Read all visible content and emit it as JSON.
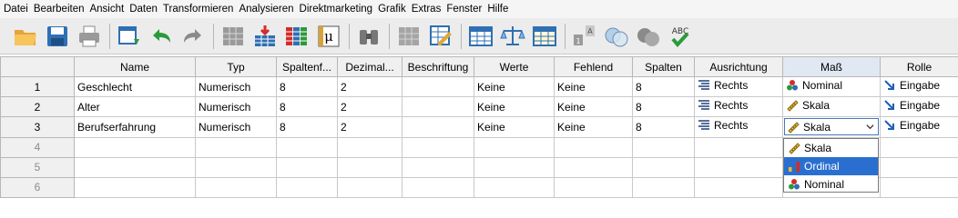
{
  "menu": [
    "Datei",
    "Bearbeiten",
    "Ansicht",
    "Daten",
    "Transformieren",
    "Analysieren",
    "Direktmarketing",
    "Grafik",
    "Extras",
    "Fenster",
    "Hilfe"
  ],
  "toolbar": {
    "icons": [
      "open-folder-icon",
      "save-icon",
      "print-icon",
      "recall-dialog-icon",
      "undo-icon",
      "redo-icon",
      "goto-case-icon",
      "goto-variable-icon",
      "variables-icon",
      "run-descriptives-icon",
      "find-icon",
      "insert-cases-icon",
      "insert-variable-icon",
      "split-file-icon",
      "weight-cases-icon",
      "select-cases-icon",
      "value-labels-icon",
      "use-sets-icon",
      "show-all-variables-icon",
      "spell-check-icon"
    ],
    "spell_label": "ABC"
  },
  "grid": {
    "headers": [
      "Name",
      "Typ",
      "Spaltenf...",
      "Dezimal...",
      "Beschriftung",
      "Werte",
      "Fehlend",
      "Spalten",
      "Ausrichtung",
      "Maß",
      "Rolle"
    ],
    "rows": [
      {
        "num": "1",
        "name": "Geschlecht",
        "typ": "Numerisch",
        "spaltenf": "8",
        "dezimal": "2",
        "beschriftung": "",
        "werte": "Keine",
        "fehlend": "Keine",
        "spalten": "8",
        "ausrichtung": "Rechts",
        "mass": "Nominal",
        "rolle": "Eingabe"
      },
      {
        "num": "2",
        "name": "Alter",
        "typ": "Numerisch",
        "spaltenf": "8",
        "dezimal": "2",
        "beschriftung": "",
        "werte": "Keine",
        "fehlend": "Keine",
        "spalten": "8",
        "ausrichtung": "Rechts",
        "mass": "Skala",
        "rolle": "Eingabe"
      },
      {
        "num": "3",
        "name": "Berufserfahrung",
        "typ": "Numerisch",
        "spaltenf": "8",
        "dezimal": "2",
        "beschriftung": "",
        "werte": "Keine",
        "fehlend": "Keine",
        "spalten": "8",
        "ausrichtung": "Rechts",
        "mass": "Skala",
        "rolle": "Eingabe"
      }
    ],
    "empty_rows": [
      "4",
      "5",
      "6"
    ]
  },
  "dropdown": {
    "options": [
      "Skala",
      "Ordinal",
      "Nominal"
    ],
    "highlighted": "Ordinal"
  },
  "colors": {
    "highlight": "#2a6fcf",
    "header_bg": "#f0f0f0",
    "toolbar_bg": "#ececec"
  }
}
